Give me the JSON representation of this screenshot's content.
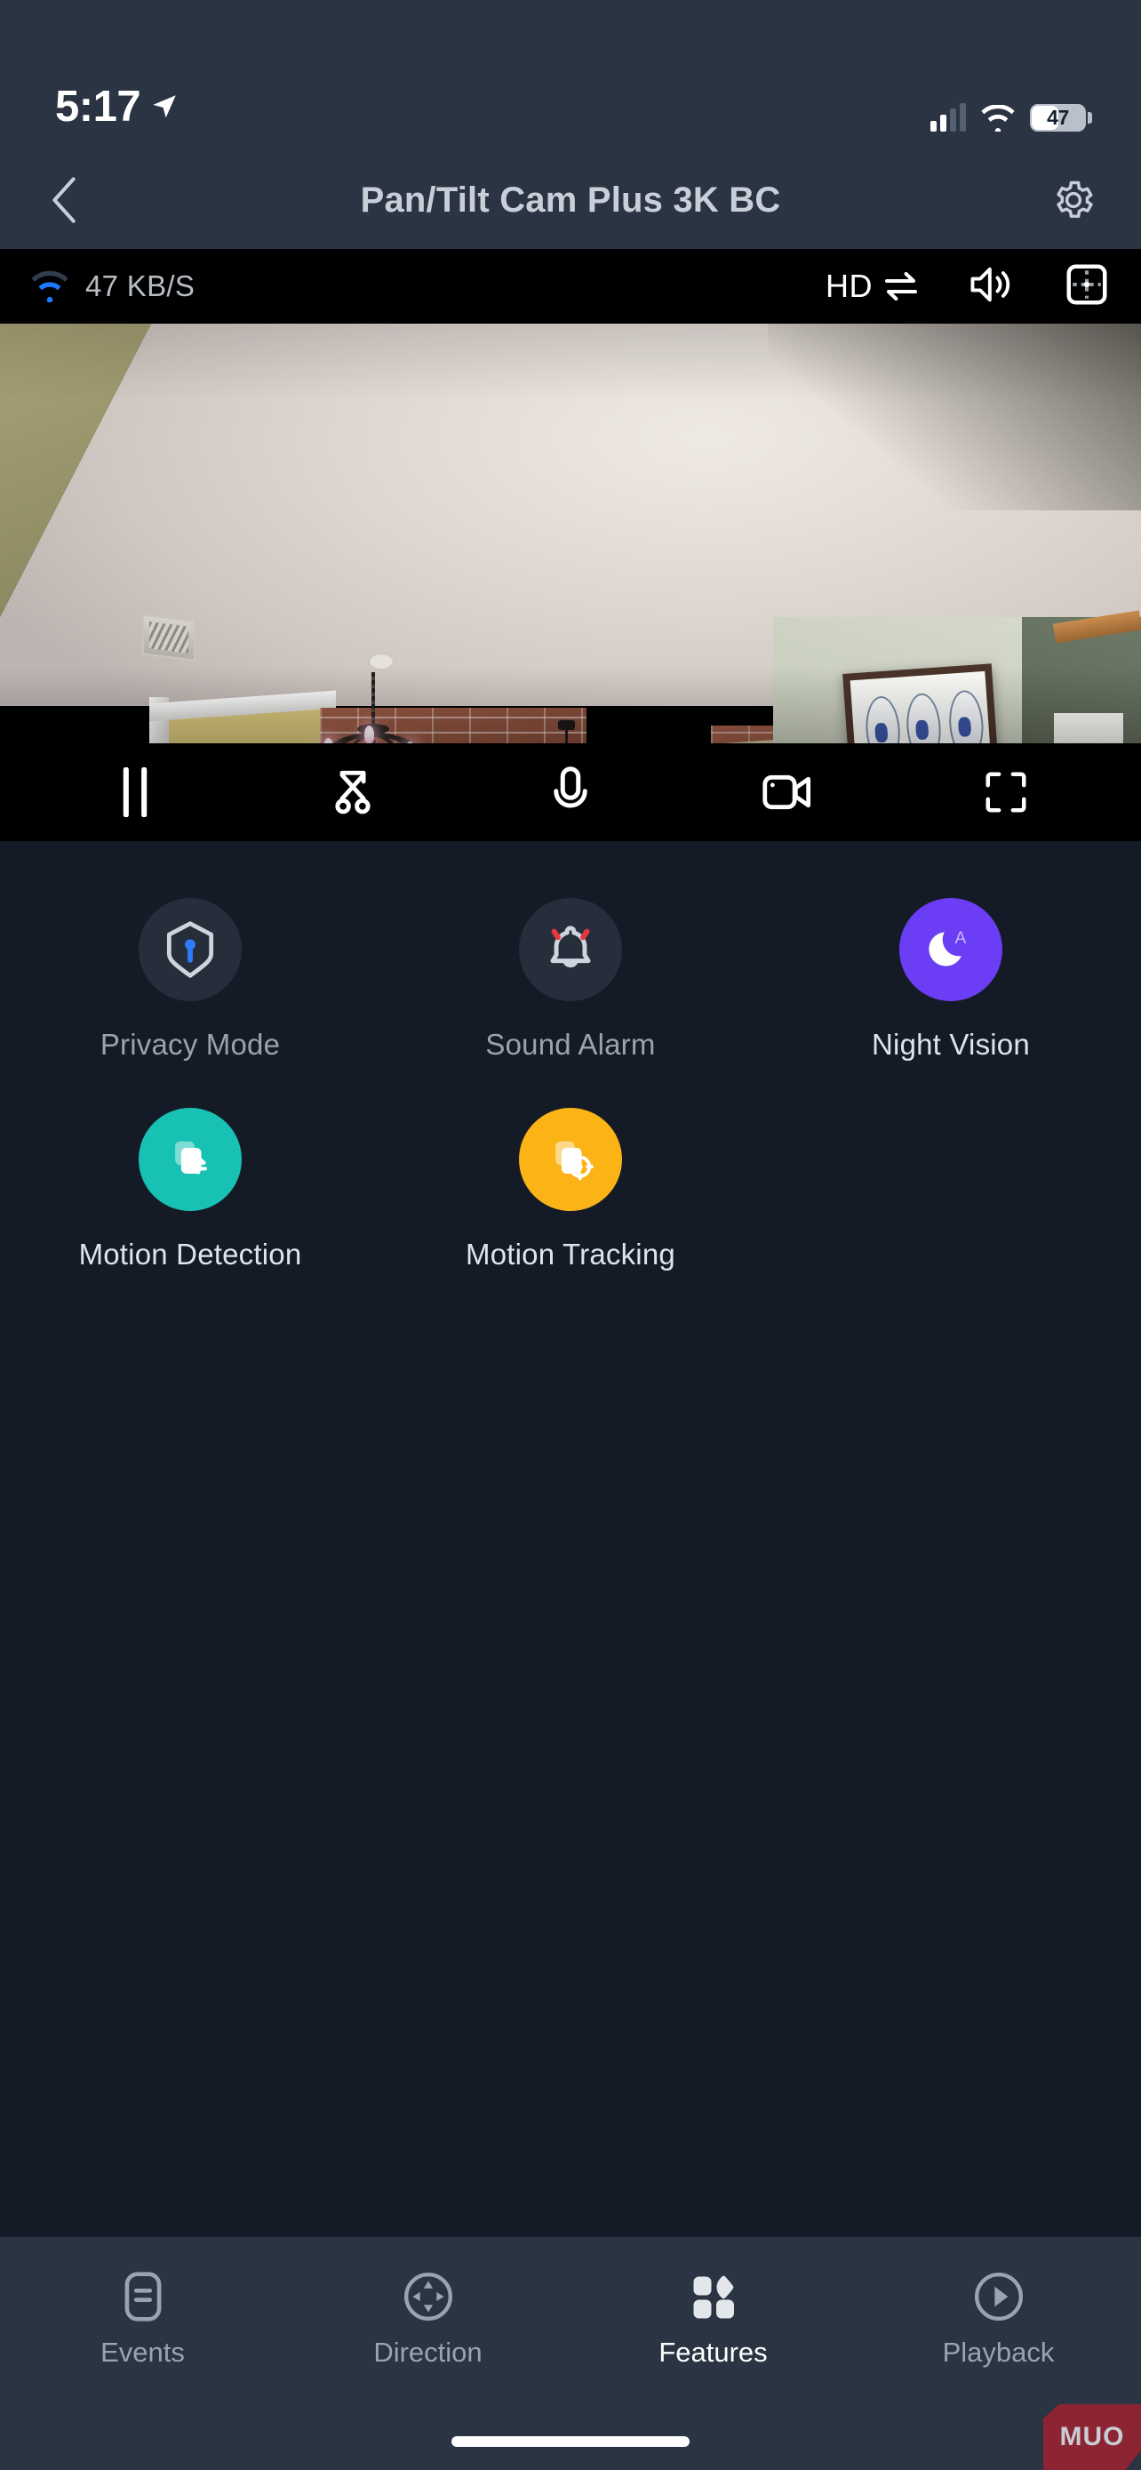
{
  "status_bar": {
    "time": "5:17",
    "location_icon": "location-arrow-icon",
    "cellular_icon": "cellular-bars-icon",
    "wifi_icon": "wifi-icon",
    "battery_level": "47",
    "battery_icon": "battery-icon"
  },
  "header": {
    "back_icon": "chevron-left-icon",
    "title": "Pan/Tilt Cam Plus 3K BC",
    "settings_icon": "gear-icon"
  },
  "video_top_bar": {
    "wifi_icon": "wifi-signal-icon",
    "bitrate": "47 KB/S",
    "quality_label": "HD",
    "quality_swap_icon": "swap-arrows-icon",
    "speaker_icon": "speaker-on-icon",
    "split_view_icon": "grid-crosshair-icon"
  },
  "video_controls": [
    {
      "name": "pause-button",
      "icon": "pause-icon"
    },
    {
      "name": "snapshot-button",
      "icon": "scissors-icon"
    },
    {
      "name": "talk-button",
      "icon": "microphone-icon"
    },
    {
      "name": "record-button",
      "icon": "camcorder-icon"
    },
    {
      "name": "fullscreen-button",
      "icon": "fullscreen-icon"
    }
  ],
  "features": [
    {
      "label": "Privacy Mode",
      "icon": "shield-keyhole-icon",
      "active": false,
      "color": "#262e3c"
    },
    {
      "label": "Sound Alarm",
      "icon": "bell-ringing-icon",
      "active": false,
      "color": "#262e3c"
    },
    {
      "label": "Night Vision",
      "icon": "moon-auto-icon",
      "active": true,
      "color": "#6b3ef5"
    },
    {
      "label": "Motion Detection",
      "icon": "motion-swap-icon",
      "active": true,
      "color": "#17c2b4"
    },
    {
      "label": "Motion Tracking",
      "icon": "motion-target-icon",
      "active": true,
      "color": "#fbb316"
    }
  ],
  "bottom_nav": [
    {
      "label": "Events",
      "icon": "list-document-icon",
      "active": false
    },
    {
      "label": "Direction",
      "icon": "dpad-circle-icon",
      "active": false
    },
    {
      "label": "Features",
      "icon": "four-squares-icon",
      "active": true
    },
    {
      "label": "Playback",
      "icon": "play-circle-icon",
      "active": false
    }
  ],
  "watermark": {
    "text": "MUO"
  },
  "colors": {
    "header_bg": "#2a3442",
    "page_bg": "#141b26",
    "video_bg": "#000000",
    "accent_purple": "#6b3ef5",
    "accent_teal": "#17c2b4",
    "accent_amber": "#fbb316",
    "inactive_circle": "#262e3c",
    "watermark_red": "#8c2433"
  }
}
